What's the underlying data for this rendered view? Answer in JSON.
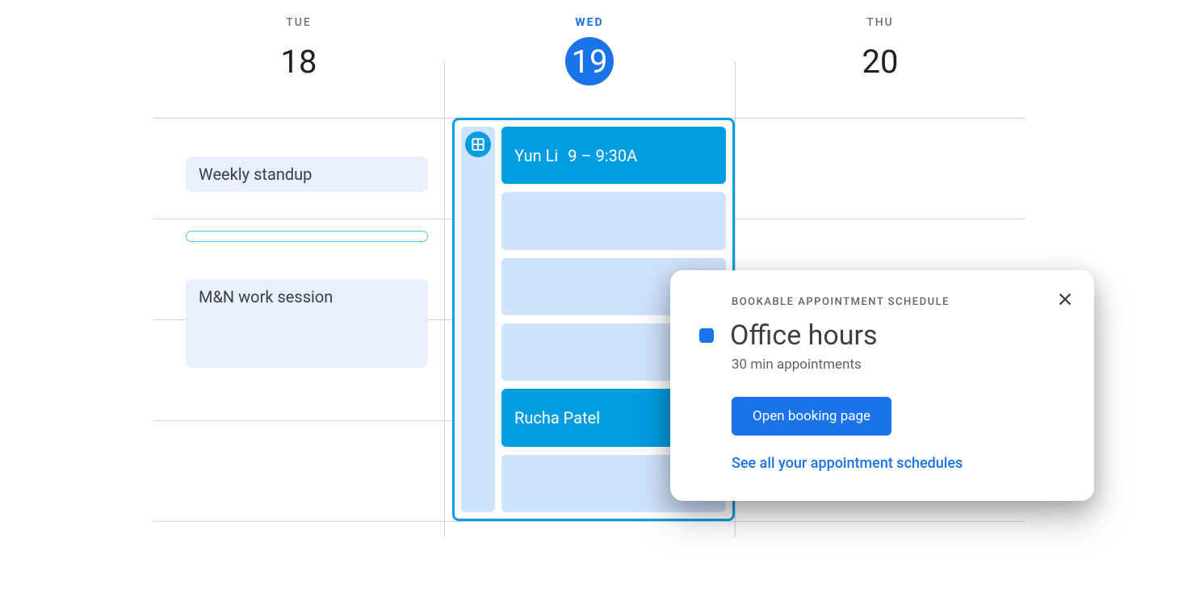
{
  "days": [
    {
      "label": "TUE",
      "number": "18",
      "active": false
    },
    {
      "label": "WED",
      "number": "19",
      "active": true
    },
    {
      "label": "THU",
      "number": "20",
      "active": false
    }
  ],
  "tue_events": {
    "standup": "Weekly standup",
    "work_session": "M&N work session"
  },
  "wed_slots": [
    {
      "name": "Yun Li",
      "time": "9 – 9:30A",
      "filled": true
    },
    {
      "name": "",
      "time": "",
      "filled": false
    },
    {
      "name": "",
      "time": "",
      "filled": false
    },
    {
      "name": "",
      "time": "",
      "filled": false
    },
    {
      "name": "Rucha Patel",
      "time": "",
      "filled": true
    },
    {
      "name": "",
      "time": "",
      "filled": false
    }
  ],
  "popup": {
    "eyebrow": "BOOKABLE APPOINTMENT SCHEDULE",
    "title": "Office hours",
    "subtitle": "30 min appointments",
    "button": "Open booking page",
    "link": "See all your appointment schedules"
  }
}
